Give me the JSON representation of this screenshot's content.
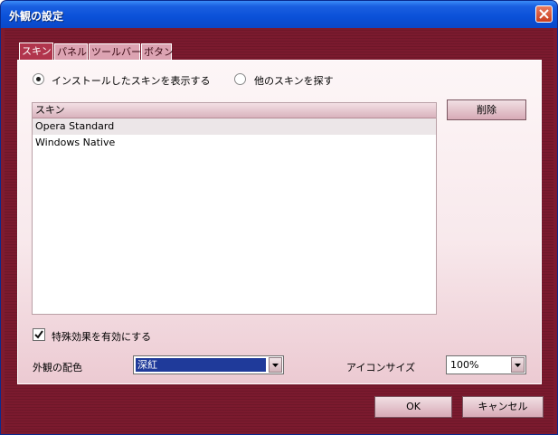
{
  "window": {
    "title": "外観の設定"
  },
  "tabs": [
    {
      "label": "スキン",
      "active": true
    },
    {
      "label": "パネル",
      "active": false
    },
    {
      "label": "ツールバー",
      "active": false
    },
    {
      "label": "ボタン",
      "active": false
    }
  ],
  "skin_source": {
    "installed_label": "インストールしたスキンを表示する",
    "installed_selected": true,
    "find_label": "他のスキンを探す",
    "find_selected": false
  },
  "skin_list": {
    "header": "スキン",
    "items": [
      "Opera Standard",
      "Windows Native"
    ],
    "selected_index": 0
  },
  "delete_button": "削除",
  "special_effects": {
    "label": "特殊効果を有効にする",
    "checked": true
  },
  "color_scheme": {
    "label": "外観の配色",
    "value": "深紅"
  },
  "icon_size": {
    "label": "アイコンサイズ",
    "value": "100%"
  },
  "footer": {
    "ok": "OK",
    "cancel": "キャンセル"
  },
  "colors": {
    "title_bar": "#0a50d8",
    "frame": "#7b1a2e",
    "active_tab": "#b1354d",
    "selection": "#1f3a9a"
  }
}
